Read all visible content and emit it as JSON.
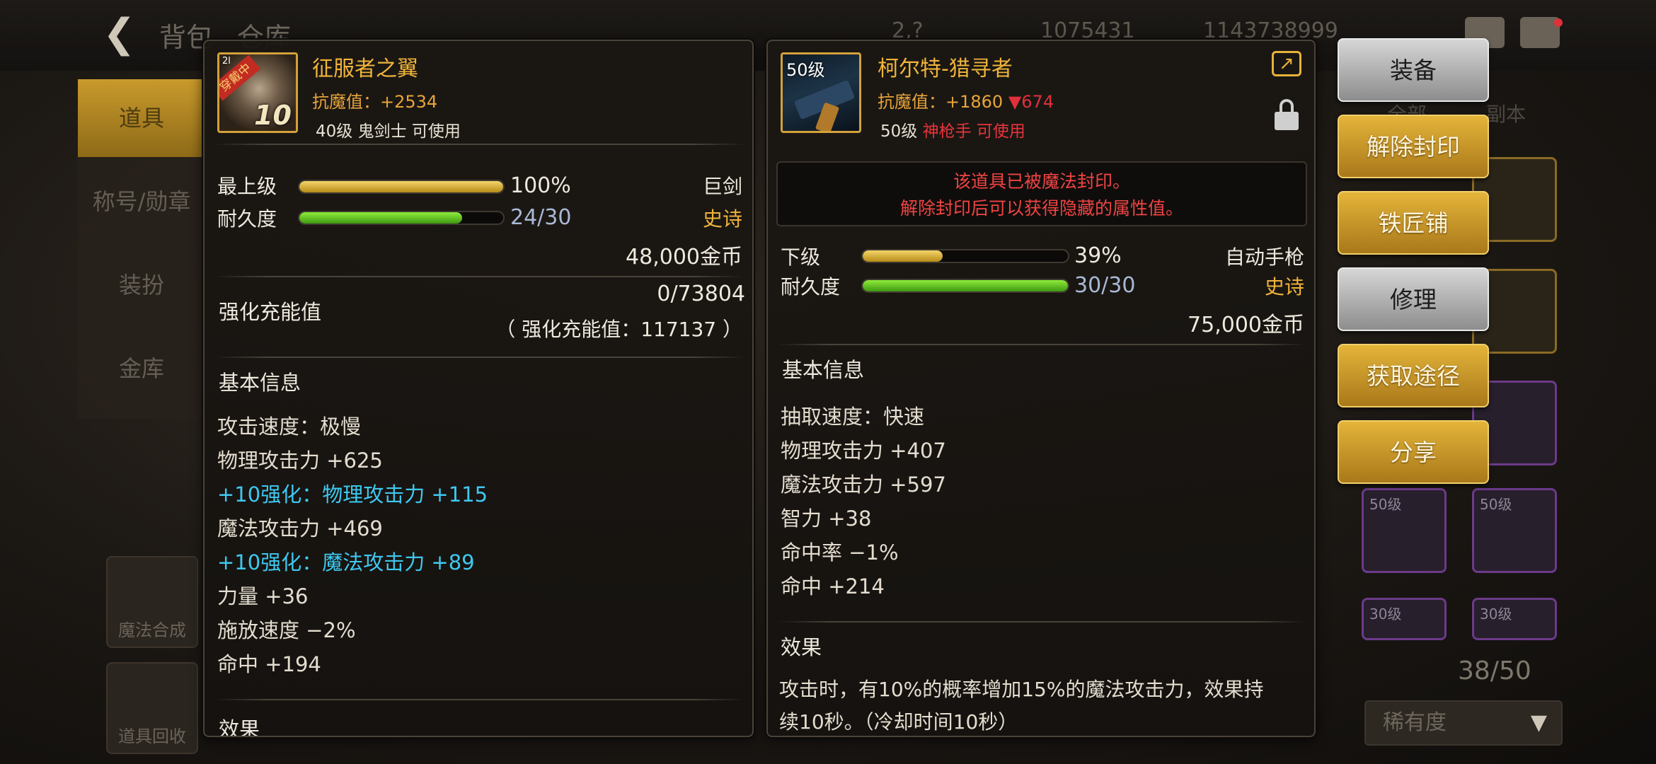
{
  "background": {
    "back_label": "背包",
    "tab2_label": "仓库",
    "currency_1": "2,?",
    "currency_2": "1075431",
    "currency_3": "1143738999",
    "left_menu": [
      "道具",
      "称号/勋章",
      "装扮",
      "金库"
    ],
    "right_tabs": [
      "全部",
      "副本"
    ],
    "tiles": [
      "魔法合成",
      "道具回收"
    ],
    "slot_labels": [
      "50级",
      "50级",
      "30级",
      "30级"
    ],
    "bag_count": "38/50",
    "sort_label": "稀有度"
  },
  "left_item": {
    "name": "征服者之翼",
    "icon_strap": "穿戴中",
    "icon_level": "10",
    "icon_small": "2l",
    "stat": "抗魔值：+2534",
    "requirement": "40级 鬼剑士 可使用",
    "grade_label": "最上级",
    "grade_percent": 100,
    "grade_text": "100%",
    "durability_label": "耐久度",
    "durability_percent": 80,
    "durability_text": "24/30",
    "type": "巨剑",
    "rarity": "史诗",
    "price": "48,000金币",
    "enhance_label": "强化充能值",
    "enhance_value": "0/73804",
    "enhance_total": "（ 强化充能值：117137 ）",
    "basic_info_title": "基本信息",
    "attributes": [
      {
        "text": "攻击速度：极慢",
        "style": "normal"
      },
      {
        "text": "物理攻击力 +625",
        "style": "normal"
      },
      {
        "text": "+10强化：物理攻击力 +115",
        "style": "cyan"
      },
      {
        "text": "魔法攻击力 +469",
        "style": "normal"
      },
      {
        "text": "+10强化：魔法攻击力 +89",
        "style": "cyan"
      },
      {
        "text": "力量 +36",
        "style": "normal"
      },
      {
        "text": "施放速度 −2%",
        "style": "normal"
      },
      {
        "text": "命中 +194",
        "style": "normal"
      }
    ],
    "effect_title": "效果"
  },
  "right_item": {
    "name": "柯尔特-猎寻者",
    "icon_level_tag": "50级",
    "stat": "抗魔值：+1860",
    "stat_diff": "▼674",
    "requirement_level": "50级",
    "requirement_class": "神枪手 可使用",
    "seal_line1": "该道具已被魔法封印。",
    "seal_line2": "解除封印后可以获得隐藏的属性值。",
    "grade_label": "下级",
    "grade_percent": 39,
    "grade_text": "39%",
    "durability_label": "耐久度",
    "durability_percent": 100,
    "durability_text": "30/30",
    "type": "自动手枪",
    "rarity": "史诗",
    "price": "75,000金币",
    "basic_info_title": "基本信息",
    "attributes": [
      "抽取速度：快速",
      "物理攻击力 +407",
      "魔法攻击力 +597",
      "智力 +38",
      "命中率 −1%",
      "命中 +214"
    ],
    "effect_title": "效果",
    "effect_line1": "攻击时，有10%的概率增加15%的魔法攻击力，效果持",
    "effect_line2": "续10秒。（冷却时间10秒）"
  },
  "actions": {
    "equip": "装备",
    "unseal": "解除封印",
    "blacksmith": "铁匠铺",
    "repair": "修理",
    "obtain": "获取途径",
    "share": "分享"
  },
  "colors": {
    "accent_gold": "#f0b43a",
    "seal_red": "#ef4444",
    "enhance_cyan": "#3fc8f0"
  }
}
